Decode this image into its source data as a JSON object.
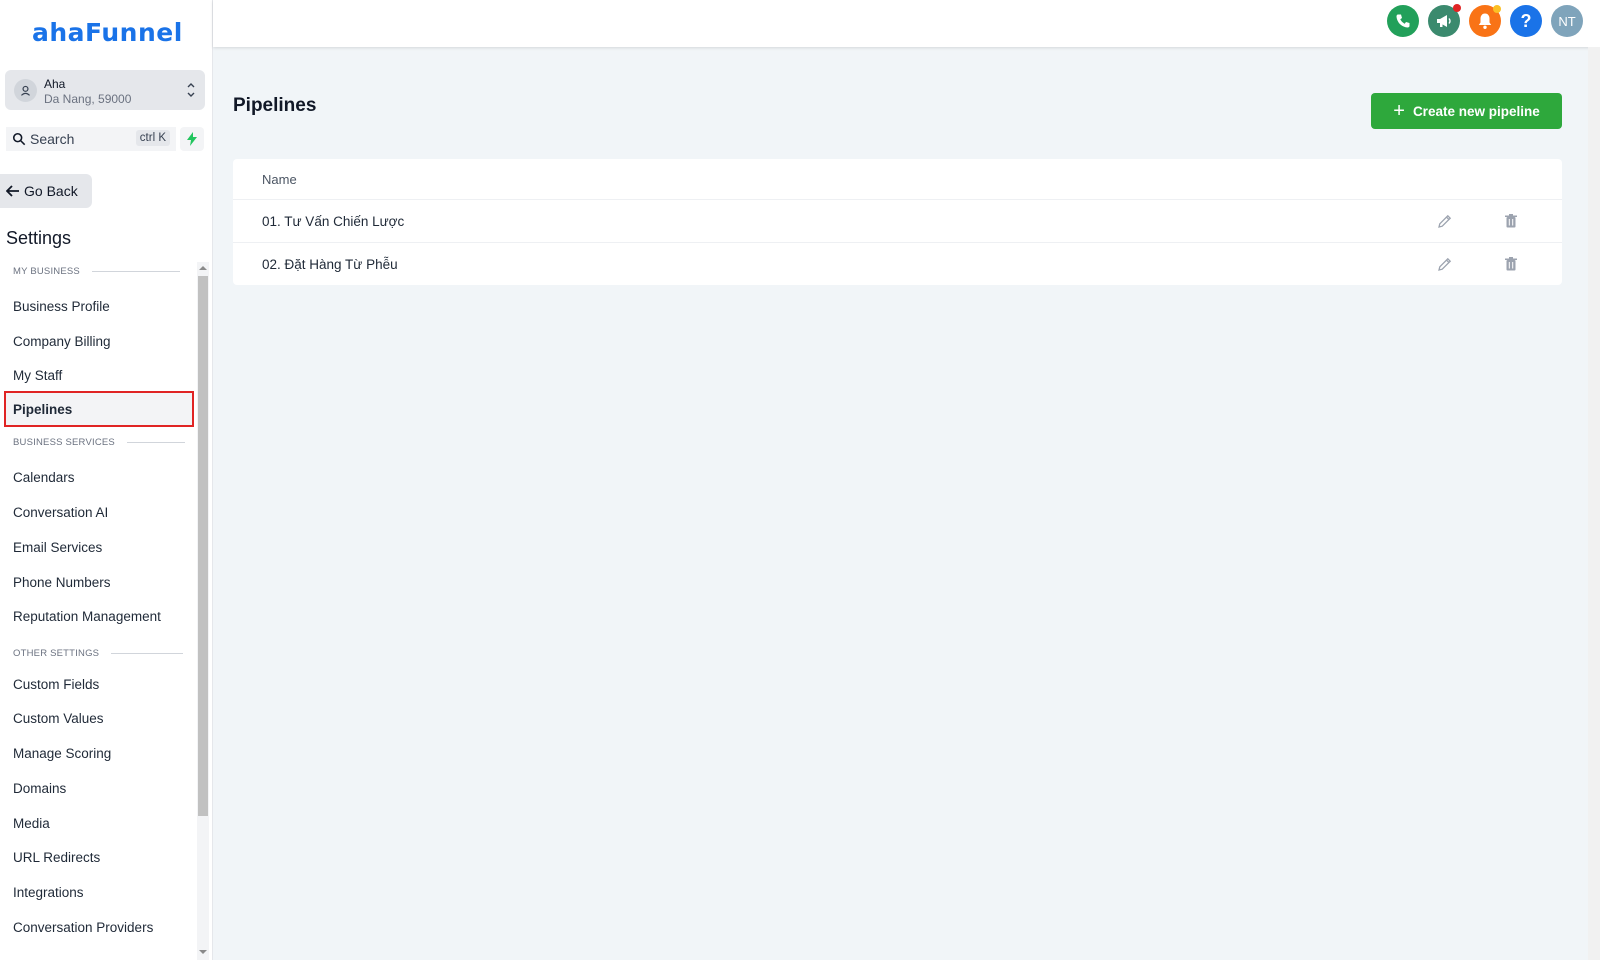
{
  "brand": {
    "logo_text": "ahaFunnel",
    "accent": "#1a73e8"
  },
  "account": {
    "name": "Aha",
    "address": "Da Nang, 59000",
    "icon": "location-icon"
  },
  "search": {
    "label": "Search",
    "shortcut": "ctrl K"
  },
  "sidebar": {
    "go_back": "Go Back",
    "title": "Settings",
    "sections": [
      {
        "label": "MY BUSINESS",
        "items": [
          "Business Profile",
          "Company Billing",
          "My Staff",
          "Pipelines"
        ]
      },
      {
        "label": "BUSINESS SERVICES",
        "items": [
          "Calendars",
          "Conversation AI",
          "Email Services",
          "Phone Numbers",
          "Reputation Management"
        ]
      },
      {
        "label": "OTHER SETTINGS",
        "items": [
          "Custom Fields",
          "Custom Values",
          "Manage Scoring",
          "Domains",
          "Media",
          "URL Redirects",
          "Integrations",
          "Conversation Providers"
        ]
      }
    ],
    "active_item": "Pipelines"
  },
  "topbar": {
    "buttons": [
      {
        "name": "phone-icon",
        "color": "#22a05a"
      },
      {
        "name": "megaphone-icon",
        "color": "#3b8a6e",
        "badge": "#e02424"
      },
      {
        "name": "bell-icon",
        "color": "#f97316",
        "badge": "#fbbf24"
      },
      {
        "name": "help-icon",
        "color": "#1a73e8",
        "label": "?"
      },
      {
        "name": "user-avatar",
        "color": "#7fa4bb",
        "label": "NT"
      }
    ]
  },
  "main": {
    "title": "Pipelines",
    "create_button": "Create new pipeline",
    "table": {
      "header": "Name",
      "rows": [
        "01. Tư Vấn Chiến Lược",
        "02. Đặt Hàng Từ Phễu"
      ]
    }
  },
  "colors": {
    "primary_button": "#2ea83c",
    "active_outline": "#e02424"
  }
}
